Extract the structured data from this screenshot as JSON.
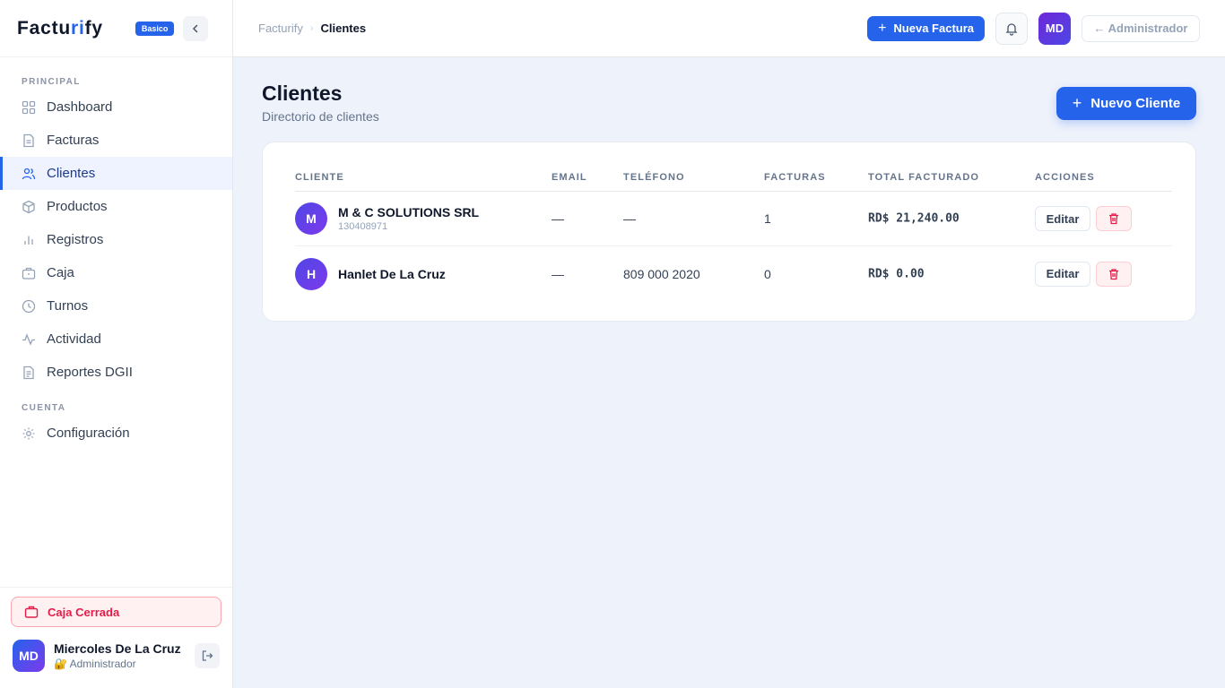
{
  "colors": {
    "accent": "#2563eb",
    "danger": "#e11d48",
    "background": "#eef2fb"
  },
  "sidebar": {
    "brand_prefix": "Factu",
    "brand_accent": "ri",
    "brand_suffix": "fy",
    "plan": "Basico",
    "sections": [
      {
        "label": "PRINCIPAL"
      },
      {
        "label": "CUENTA"
      }
    ],
    "items": [
      {
        "label": "Dashboard",
        "icon": "grid-icon"
      },
      {
        "label": "Facturas",
        "icon": "document-icon"
      },
      {
        "label": "Clientes",
        "icon": "users-icon",
        "active": true
      },
      {
        "label": "Productos",
        "icon": "cube-icon"
      },
      {
        "label": "Registros",
        "icon": "bar-chart-icon"
      },
      {
        "label": "Caja",
        "icon": "briefcase-icon"
      },
      {
        "label": "Turnos",
        "icon": "clock-icon"
      },
      {
        "label": "Actividad",
        "icon": "activity-icon"
      },
      {
        "label": "Reportes DGII",
        "icon": "report-icon"
      },
      {
        "label": "Configuración",
        "icon": "gear-icon"
      }
    ],
    "caja_status": "Caja Cerrada",
    "user": {
      "initials": "MD",
      "name": "Miercoles De La Cruz",
      "role_emoji": "🔐",
      "role": "Administrador"
    }
  },
  "topbar": {
    "breadcrumb_root": "Facturify",
    "breadcrumb_sep": "›",
    "breadcrumb_current": "Clientes",
    "new_invoice": "Nueva Factura",
    "avatar_initials": "MD",
    "admin_button": "← Administrador"
  },
  "page": {
    "title": "Clientes",
    "subtitle": "Directorio de clientes",
    "new_client": "Nuevo Cliente"
  },
  "table": {
    "columns": [
      "CLIENTE",
      "EMAIL",
      "TELÉFONO",
      "FACTURAS",
      "TOTAL FACTURADO",
      "ACCIONES"
    ],
    "edit_label": "Editar",
    "rows": [
      {
        "initial": "M",
        "name": "M & C SOLUTIONS SRL",
        "rnc": "130408971",
        "email": "—",
        "phone": "—",
        "invoices": "1",
        "total": "RD$ 21,240.00"
      },
      {
        "initial": "H",
        "name": "Hanlet De La Cruz",
        "rnc": "",
        "email": "—",
        "phone": "809 000 2020",
        "invoices": "0",
        "total": "RD$ 0.00"
      }
    ]
  }
}
